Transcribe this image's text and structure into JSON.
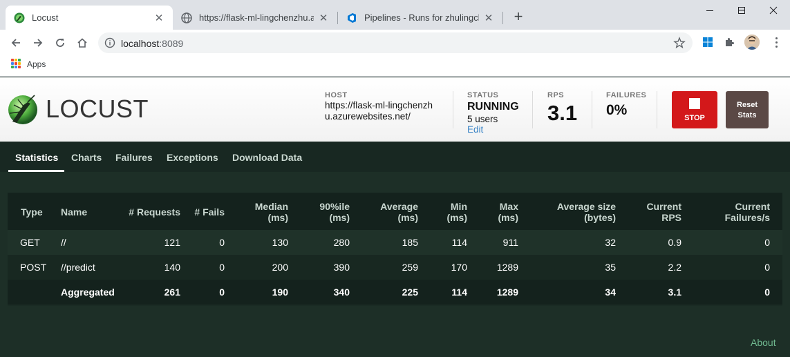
{
  "browser": {
    "tabs": [
      {
        "title": "Locust",
        "active": true,
        "favicon": "locust-logo"
      },
      {
        "title": "https://flask-ml-lingchenzhu.azurewebsites.net/",
        "active": false,
        "favicon": "globe-icon"
      },
      {
        "title": "Pipelines - Runs for zhulingchen/flask-ml-azure-serverless",
        "active": false,
        "favicon": "azure-devops-icon"
      }
    ],
    "url_host": "localhost",
    "url_port": ":8089",
    "bookmarks": [
      {
        "label": "Apps"
      }
    ]
  },
  "header": {
    "logo_text": "LOCUST",
    "host": {
      "label": "HOST",
      "value": "https://flask-ml-lingchenzhu.azurewebsites.net/"
    },
    "status": {
      "label": "STATUS",
      "value": "RUNNING",
      "users": "5 users",
      "edit": "Edit"
    },
    "rps": {
      "label": "RPS",
      "value": "3.1"
    },
    "failures": {
      "label": "FAILURES",
      "value": "0%"
    },
    "stop_label": "STOP",
    "reset_line1": "Reset",
    "reset_line2": "Stats"
  },
  "nav": {
    "tabs": [
      "Statistics",
      "Charts",
      "Failures",
      "Exceptions",
      "Download Data"
    ],
    "active": "Statistics"
  },
  "table": {
    "columns": [
      {
        "l1": "Type",
        "l2": ""
      },
      {
        "l1": "Name",
        "l2": ""
      },
      {
        "l1": "# Requests",
        "l2": ""
      },
      {
        "l1": "# Fails",
        "l2": ""
      },
      {
        "l1": "Median",
        "l2": "(ms)"
      },
      {
        "l1": "90%ile",
        "l2": "(ms)"
      },
      {
        "l1": "Average",
        "l2": "(ms)"
      },
      {
        "l1": "Min",
        "l2": "(ms)"
      },
      {
        "l1": "Max",
        "l2": "(ms)"
      },
      {
        "l1": "Average size",
        "l2": "(bytes)"
      },
      {
        "l1": "Current",
        "l2": "RPS"
      },
      {
        "l1": "Current",
        "l2": "Failures/s"
      }
    ],
    "rows": [
      [
        "GET",
        "//",
        "121",
        "0",
        "130",
        "280",
        "185",
        "114",
        "911",
        "32",
        "0.9",
        "0"
      ],
      [
        "POST",
        "//predict",
        "140",
        "0",
        "200",
        "390",
        "259",
        "170",
        "1289",
        "35",
        "2.2",
        "0"
      ],
      [
        "",
        "Aggregated",
        "261",
        "0",
        "190",
        "340",
        "225",
        "114",
        "1289",
        "34",
        "3.1",
        "0"
      ]
    ]
  },
  "footer": {
    "about": "About"
  },
  "colors": {
    "stop": "#d3181a",
    "reset": "#5a4845",
    "background": "#1d2f27",
    "link": "#6fb88f"
  }
}
